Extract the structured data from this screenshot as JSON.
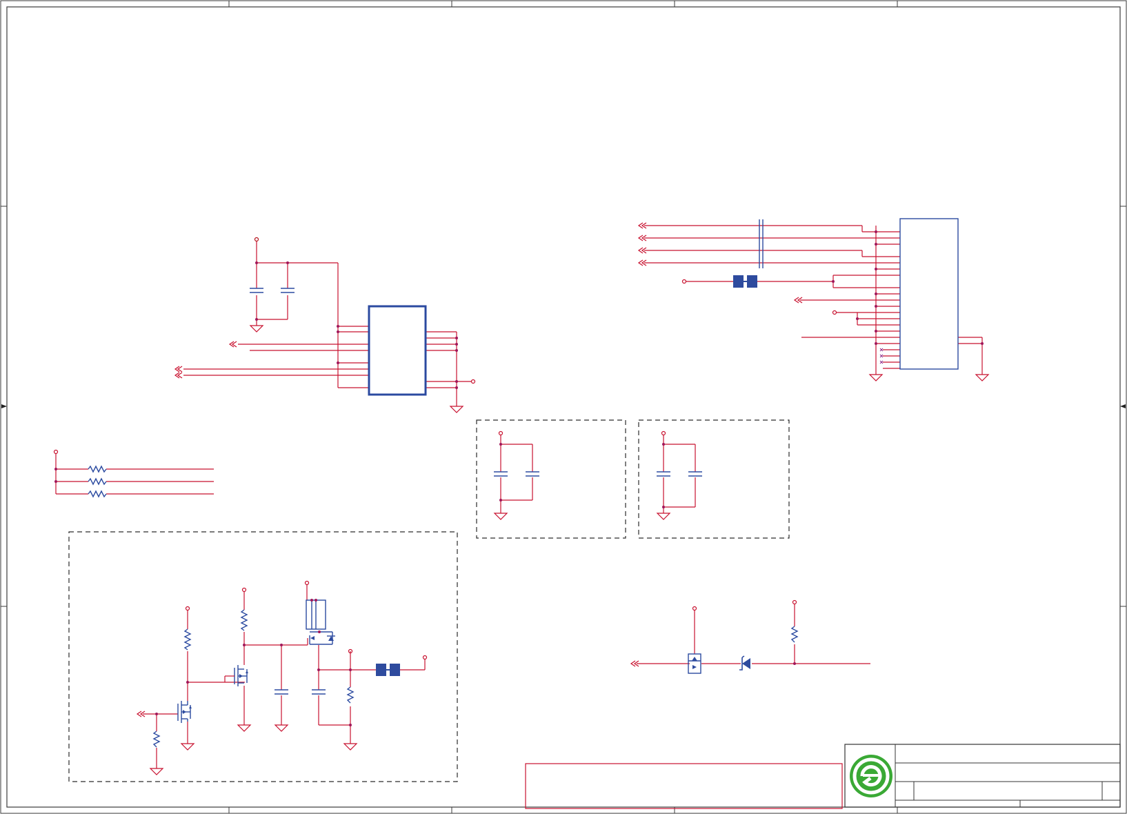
{
  "drawing": {
    "logo_icon": "e-circle-logo-icon",
    "colors": {
      "wire": "#c8102e",
      "component": "#2e4b9e",
      "junction": "#a0165a",
      "frame": "#3a3a3a",
      "logo": "#3aa935"
    }
  }
}
